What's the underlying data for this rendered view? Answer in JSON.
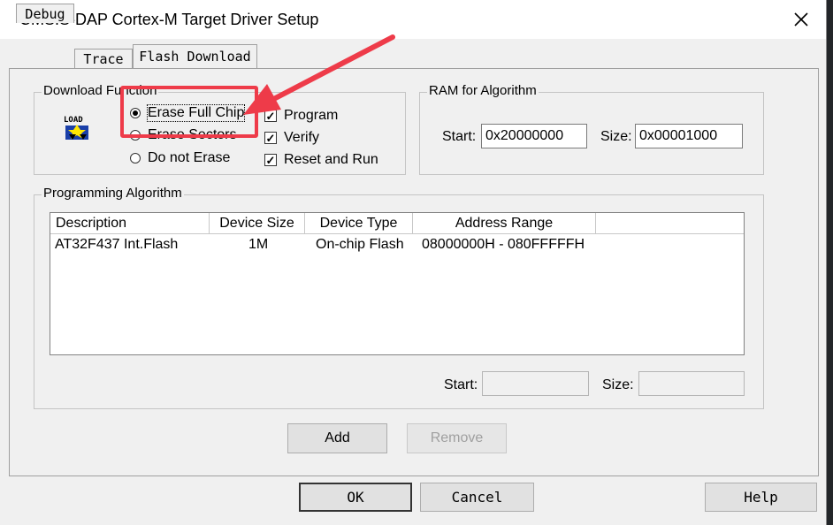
{
  "window": {
    "title": "CMSIS-DAP Cortex-M Target Driver Setup"
  },
  "tabs": [
    {
      "label": "Debug"
    },
    {
      "label": "Trace"
    },
    {
      "label": "Flash Download"
    }
  ],
  "download_function": {
    "legend": "Download Function",
    "icon_text": "LOAD",
    "radios": [
      {
        "label": "Erase Full Chip",
        "selected": true
      },
      {
        "label": "Erase Sectors",
        "selected": false
      },
      {
        "label": "Do not Erase",
        "selected": false
      }
    ],
    "checks": [
      {
        "label": "Program",
        "checked": true
      },
      {
        "label": "Verify",
        "checked": true
      },
      {
        "label": "Reset and Run",
        "checked": true
      }
    ]
  },
  "ram": {
    "legend": "RAM for Algorithm",
    "start_label": "Start:",
    "start_value": "0x20000000",
    "size_label": "Size:",
    "size_value": "0x00001000"
  },
  "programming": {
    "legend": "Programming Algorithm",
    "columns": [
      "Description",
      "Device Size",
      "Device Type",
      "Address Range"
    ],
    "rows": [
      {
        "description": "AT32F437 Int.Flash",
        "size": "1M",
        "type": "On-chip Flash",
        "range": "08000000H - 080FFFFFH"
      }
    ],
    "start_label": "Start:",
    "start_value": "",
    "size_label": "Size:",
    "size_value": ""
  },
  "buttons": {
    "add": "Add",
    "remove": "Remove",
    "ok": "OK",
    "cancel": "Cancel",
    "help": "Help"
  },
  "colors": {
    "annotation": "#ee3b49"
  }
}
